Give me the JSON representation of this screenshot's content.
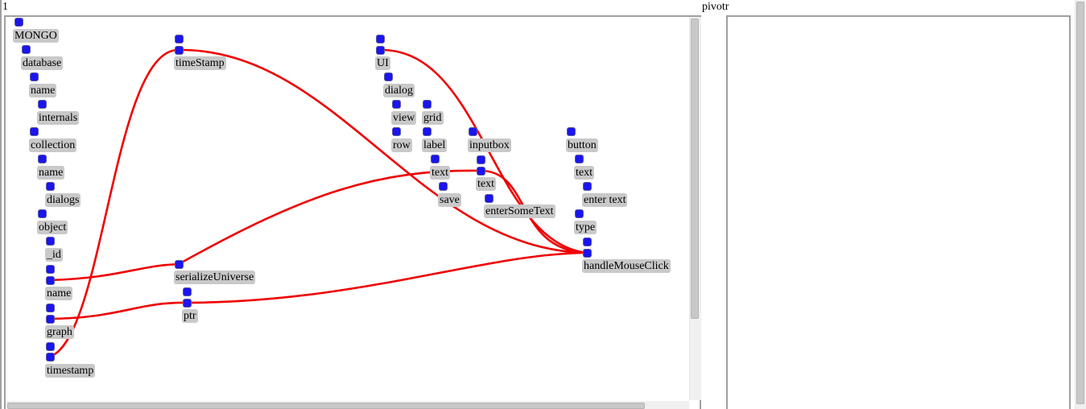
{
  "headers": {
    "left_title": "1",
    "right_title": "pivotr"
  },
  "nodes": [
    {
      "label": "MONGO"
    },
    {
      "label": "database"
    },
    {
      "label": "name"
    },
    {
      "label": "internals"
    },
    {
      "label": "collection"
    },
    {
      "label": "name"
    },
    {
      "label": "dialogs"
    },
    {
      "label": "object"
    },
    {
      "label": "_id"
    },
    {
      "label": "name"
    },
    {
      "label": "graph"
    },
    {
      "label": "timestamp"
    },
    {
      "label": "timeStamp"
    },
    {
      "label": "serializeUniverse"
    },
    {
      "label": "ptr"
    },
    {
      "label": "UI"
    },
    {
      "label": "dialog"
    },
    {
      "label": "view"
    },
    {
      "label": "row"
    },
    {
      "label": "grid"
    },
    {
      "label": "label"
    },
    {
      "label": "text"
    },
    {
      "label": "save"
    },
    {
      "label": "inputbox"
    },
    {
      "label": "text"
    },
    {
      "label": "enterSomeText"
    },
    {
      "label": "button"
    },
    {
      "label": "text"
    },
    {
      "label": "enter text"
    },
    {
      "label": "type"
    },
    {
      "label": "handleMouseClick"
    }
  ],
  "colors": {
    "port": "#1a14f0",
    "wire": "#ee0000",
    "label_bg": "#c9c9c9"
  }
}
